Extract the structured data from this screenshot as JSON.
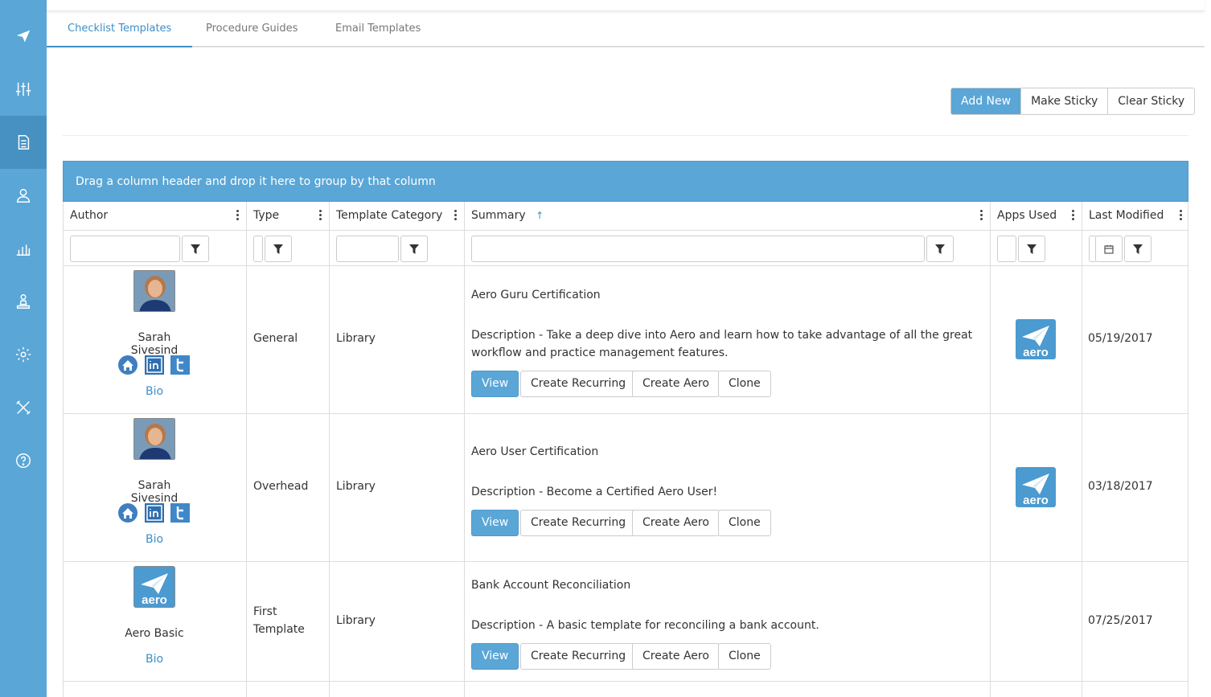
{
  "tabs": [
    {
      "label": "Checklist Templates"
    },
    {
      "label": "Procedure Guides"
    },
    {
      "label": "Email Templates"
    }
  ],
  "toolbar": {
    "add_new": "Add New",
    "make_sticky": "Make Sticky",
    "clear_sticky": "Clear Sticky"
  },
  "group_bar": "Drag a column header and drop it here to group by that column",
  "columns": {
    "author": "Author",
    "type": "Type",
    "category": "Template Category",
    "summary": "Summary",
    "sort_arrow": "↑",
    "apps": "Apps Used",
    "modified": "Last Modified"
  },
  "actions": {
    "view": "View",
    "recurring": "Create Recurring",
    "aero": "Create Aero",
    "clone": "Clone"
  },
  "bio_label": "Bio",
  "logo_text": "aero",
  "colors": {
    "brand": "#5aa6d6",
    "accent_text": "#3f8fc7"
  },
  "rows": [
    {
      "author": "Sarah Sivesind",
      "type": "General",
      "category": "Library",
      "title": "Aero Guru Certification",
      "description": "Description - Take a deep dive into Aero and learn how to take advantage of all the great",
      "description2": "workflow and practice management features.",
      "modified": "05/19/2017"
    },
    {
      "author": "Sarah Sivesind",
      "type": "Overhead",
      "category": "Library",
      "title": "Aero User Certification",
      "description": "Description - Become a Certified Aero User!",
      "modified": "03/18/2017"
    },
    {
      "author": "Aero Basic",
      "type_line1": "First",
      "type_line2": "Template",
      "category": "Library",
      "title": "Bank Account Reconciliation",
      "description": "Description - A basic template for reconciling a bank account.",
      "modified": "07/25/2017"
    }
  ]
}
